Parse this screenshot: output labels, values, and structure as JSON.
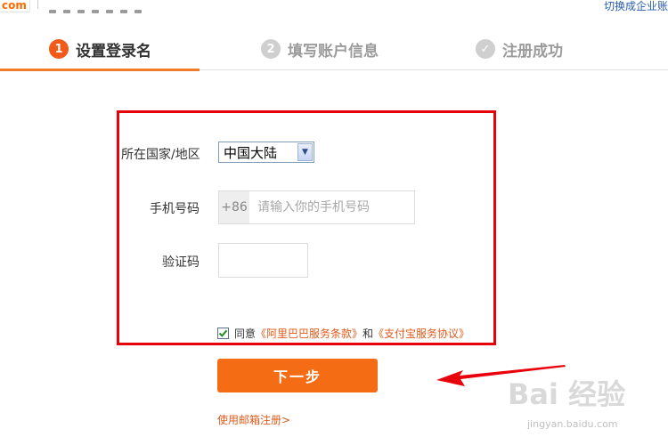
{
  "header": {
    "logo_text": "com",
    "switch_link": "切换成企业账"
  },
  "steps": [
    {
      "num": "1",
      "label": "设置登录名",
      "state": "active"
    },
    {
      "num": "2",
      "label": "填写账户信息",
      "state": "inactive"
    },
    {
      "num": "✓",
      "label": "注册成功",
      "state": "inactive"
    }
  ],
  "form": {
    "country_label": "所在国家/地区",
    "country_value": "中国大陆",
    "phone_label": "手机号码",
    "phone_prefix": "+86",
    "phone_placeholder": "请输入你的手机号码",
    "code_label": "验证码",
    "code_value": "",
    "agree_checked": true,
    "agree_prefix": "同意",
    "agree_link1": "《阿里巴巴服务条款》",
    "agree_and": "和",
    "agree_link2": "《支付宝服务协议》",
    "next_button": "下一步",
    "email_register_link": "使用邮箱注册>"
  },
  "watermark": {
    "main": "Bai 经验",
    "sub": "jingyan.baidu.com"
  },
  "colors": {
    "accent": "#f46c14",
    "active_step": "#f25a1a",
    "highlight_border": "#e8000a",
    "link": "#e05a1a"
  }
}
